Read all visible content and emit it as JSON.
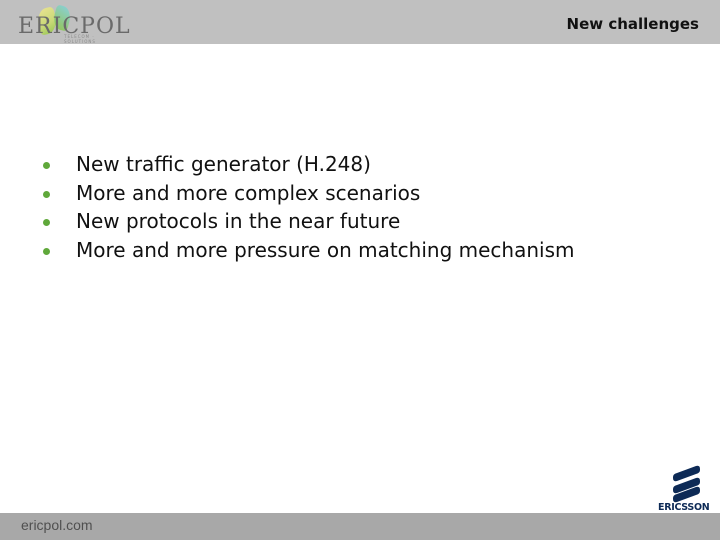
{
  "header": {
    "logo_text": "ERICPOL",
    "logo_subtext": "TELECOM · SOLUTIONS",
    "title": "New challenges"
  },
  "content": {
    "bullets": [
      "New traffic generator (H.248)",
      "More and more complex scenarios",
      "New protocols in the near future",
      "More and more pressure on matching mechanism"
    ]
  },
  "footer": {
    "website": "ericpol.com",
    "partner_logo_text": "ERICSSON"
  },
  "colors": {
    "header_bg": "#c0c0c0",
    "footer_bg": "#a8a8a8",
    "bullet": "#5fa83a",
    "ericsson_blue": "#0d2a56"
  }
}
